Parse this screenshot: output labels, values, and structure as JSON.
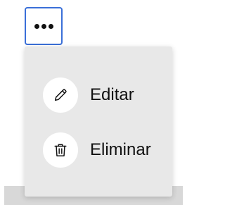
{
  "more_button": {
    "icon": "ellipsis-horizontal-icon",
    "border_color": "#3a6fd8"
  },
  "menu": {
    "background": "#e8e8e8",
    "items": [
      {
        "label": "Editar",
        "icon": "pencil-icon"
      },
      {
        "label": "Eliminar",
        "icon": "trash-icon"
      }
    ]
  }
}
